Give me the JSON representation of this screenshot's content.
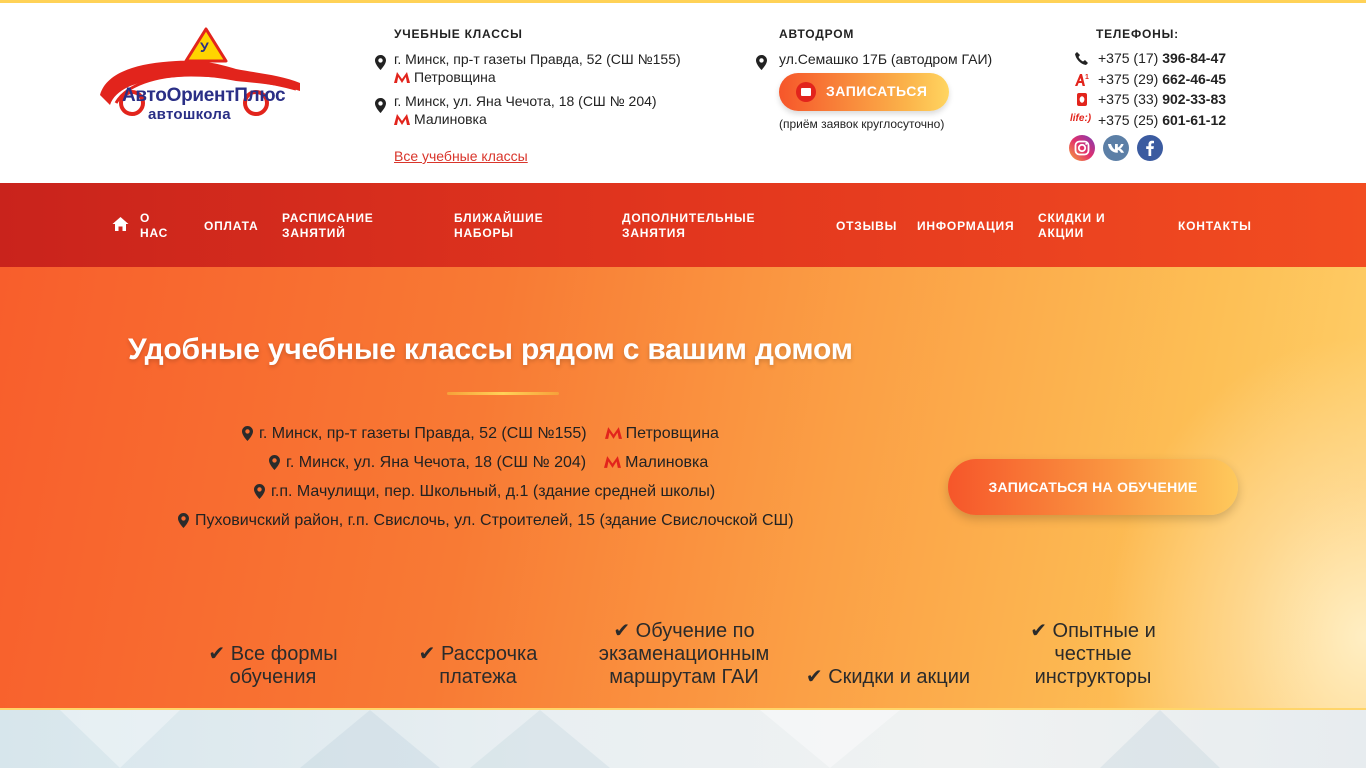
{
  "logo": {
    "name": "АвтоОриентПлюс",
    "sub": "автошкола",
    "badge": "У"
  },
  "classes": {
    "title": "УЧЕБНЫЕ КЛАССЫ",
    "items": [
      {
        "address": "г. Минск, пр-т газеты Правда, 52 (СШ №155)",
        "metro": "Петровщина"
      },
      {
        "address": "г. Минск, ул. Яна Чечота, 18 (СШ № 204)",
        "metro": "Малиновка"
      }
    ],
    "all_link": "Все учебные классы"
  },
  "autodrom": {
    "title": "АВТОДРОМ",
    "address": "ул.Семашко 17Б (автодром ГАИ)",
    "signup_label": "ЗАПИСАТЬСЯ",
    "note": "(приём заявок круглосуточно)"
  },
  "phones": {
    "title": "ТЕЛЕФОНЫ:",
    "items": [
      {
        "icon": "phone-icon",
        "code": "+375 (17)",
        "number": "396-84-47"
      },
      {
        "icon": "a1-icon",
        "code": "+375 (29)",
        "number": "662-46-45"
      },
      {
        "icon": "mts-icon",
        "code": "+375 (33)",
        "number": "902-33-83"
      },
      {
        "icon": "life-icon",
        "code": "+375 (25)",
        "number": "601-61-12"
      }
    ],
    "life_label": "life:)",
    "social": [
      "instagram-icon",
      "vk-icon",
      "facebook-icon"
    ]
  },
  "nav": {
    "items": [
      {
        "line1": "О",
        "line2": "НАС"
      },
      {
        "line1": "ОПЛАТА",
        "line2": ""
      },
      {
        "line1": "РАСПИСАНИЕ",
        "line2": "ЗАНЯТИЙ"
      },
      {
        "line1": "БЛИЖАЙШИЕ",
        "line2": "НАБОРЫ"
      },
      {
        "line1": "ДОПОЛНИТЕЛЬНЫЕ",
        "line2": "ЗАНЯТИЯ"
      },
      {
        "line1": "ОТЗЫВЫ",
        "line2": ""
      },
      {
        "line1": "ИНФОРМАЦИЯ",
        "line2": ""
      },
      {
        "line1": "СКИДКИ И",
        "line2": "АКЦИИ"
      },
      {
        "line1": "КОНТАКТЫ",
        "line2": ""
      }
    ]
  },
  "hero": {
    "title": "Удобные учебные классы рядом с вашим домом",
    "addresses": [
      {
        "text": "г. Минск, пр-т газеты Правда, 52 (СШ №155)",
        "metro": "Петровщина"
      },
      {
        "text": "г. Минск, ул. Яна Чечота, 18 (СШ № 204)",
        "metro": "Малиновка"
      },
      {
        "text": "г.п. Мачулищи, пер. Школьный, д.1 (здание средней школы)",
        "metro": ""
      },
      {
        "text": "Пуховичский район, г.п. Свислочь, ул. Строителей, 15 (здание Свислочской СШ)",
        "metro": ""
      }
    ],
    "cta": "ЗАПИСАТЬСЯ НА ОБУЧЕНИЕ",
    "features": [
      {
        "l1": "✔ Все формы",
        "l2": "обучения",
        "l3": ""
      },
      {
        "l1": "✔ Рассрочка",
        "l2": "платежа",
        "l3": ""
      },
      {
        "l1": "✔ Обучение по",
        "l2": "экзаменационным",
        "l3": "маршрутам ГАИ"
      },
      {
        "l1": "✔ Скидки и акции",
        "l2": "",
        "l3": ""
      },
      {
        "l1": "✔ Опытные и",
        "l2": "честные",
        "l3": "инструкторы"
      }
    ]
  },
  "colors": {
    "nav_red": "#d9301d",
    "accent_orange": "#f6562a",
    "accent_yellow": "#ffd257",
    "brand_blue": "#2a2f86",
    "link_red": "#d9352b"
  }
}
